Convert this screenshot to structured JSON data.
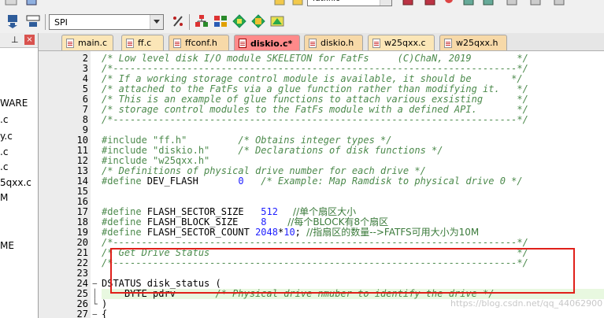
{
  "toolbar": {
    "target_name": "SPI",
    "top_combo_value": "fatfinic"
  },
  "project_panel": {
    "items": [
      "WARE",
      ".c",
      "y.c",
      ".c",
      ".c",
      "5qxx.c",
      "M",
      "ME"
    ]
  },
  "tabs": [
    {
      "label": "main.c",
      "kind": "c"
    },
    {
      "label": "ff.c",
      "kind": "c"
    },
    {
      "label": "ffconf.h",
      "kind": "h"
    },
    {
      "label": "diskio.c*",
      "kind": "c",
      "active": true
    },
    {
      "label": "diskio.h",
      "kind": "h"
    },
    {
      "label": "w25qxx.c",
      "kind": "c"
    },
    {
      "label": "w25qxx.h",
      "kind": "h"
    }
  ],
  "editor": {
    "line_numbers": [
      "2",
      "3",
      "4",
      "5",
      "6",
      "7",
      "8",
      "9",
      "10",
      "11",
      "12",
      "13",
      "14",
      "15",
      "16",
      "17",
      "18",
      "19",
      "20",
      "21",
      "22",
      "23",
      "24",
      "25",
      "26",
      "27"
    ],
    "lines": {
      "l2": "/* Low level disk I/O module SKELETON for FatFs     (C)ChaN, 2019        */",
      "l3": "/*-----------------------------------------------------------------------*/",
      "l4": "/* If a working storage control module is available, it should be       */",
      "l5": "/* attached to the FatFs via a glue function rather than modifying it.   */",
      "l6": "/* This is an example of glue functions to attach various exsisting      */",
      "l7": "/* storage control modules to the FatFs module with a defined API.       */",
      "l8": "/*-----------------------------------------------------------------------*/",
      "l10_kw": "#include ",
      "l10_str": "\"ff.h\"",
      "l10_cm": "         /* Obtains integer types */",
      "l11_kw": "#include ",
      "l11_str": "\"diskio.h\"",
      "l11_cm": "     /* Declarations of disk functions */",
      "l12_kw": "#include ",
      "l12_str": "\"w25qxx.h\"",
      "l13": "/* Definitions of physical drive number for each drive */",
      "l14_kw": "#define ",
      "l14_name": "DEV_FLASH       ",
      "l14_num": "0",
      "l14_cm": "   /* Example: Map Ramdisk to physical drive 0 */",
      "l17_kw": "#define ",
      "l17_name": "FLASH_SECTOR_SIZE   ",
      "l17_num": "512",
      "l17_cm": "     //单个扇区大小",
      "l18_kw": "#define ",
      "l18_name": "FLASH_BLOCK_SIZE    ",
      "l18_num": "8",
      "l18_cm": "       //每个BLOCK有8个扇区",
      "l19_kw": "#define ",
      "l19_name": "FLASH_SECTOR_COUNT ",
      "l19_num1": "2048",
      "l19_op": "*",
      "l19_num2": "10",
      "l19_rest": "; ",
      "l19_cm": "//指扇区的数量-->FATFS可用大小为10M",
      "l20": "/*-----------------------------------------------------------------------*/",
      "l21": "/* Get Drive Status                                                      */",
      "l22": "/*-----------------------------------------------------------------------*/",
      "l24": "DSTATUS disk_status (",
      "l25_code": "    BYTE pdrv       ",
      "l25_cm": "/* Physical drive nmuber to identify the drive */",
      "l26": ")",
      "l27": "{"
    }
  },
  "watermark": "https://blog.csdn.net/qq_44062900",
  "colors": {
    "active_tab": "#ff8a8a",
    "c_tab": "#fbe6b7",
    "comment": "#4c8a4c",
    "number": "#2020ff",
    "annotation_box": "#e0201a"
  }
}
